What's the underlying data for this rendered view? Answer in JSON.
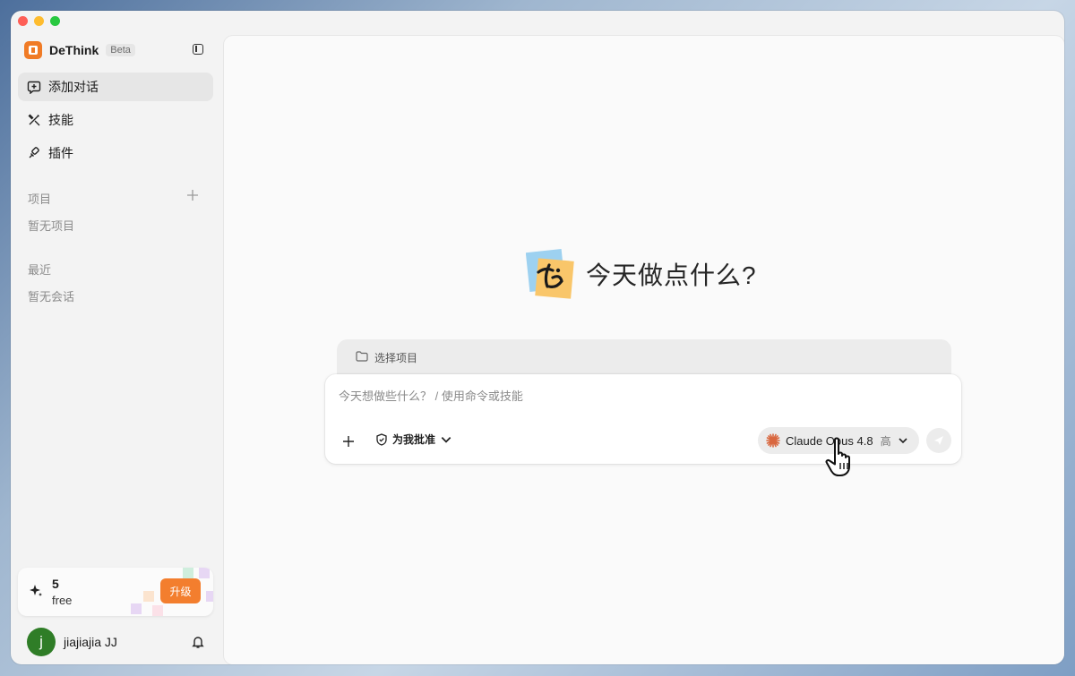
{
  "app": {
    "name": "DeThink",
    "badge": "Beta"
  },
  "sidebar": {
    "nav": [
      {
        "label": "添加对话",
        "icon": "new-chat-icon"
      },
      {
        "label": "技能",
        "icon": "skills-icon"
      },
      {
        "label": "插件",
        "icon": "plugin-icon"
      }
    ],
    "projects": {
      "title": "项目",
      "empty": "暂无项目"
    },
    "recent": {
      "title": "最近",
      "empty": "暂无会话"
    },
    "credits": {
      "count": "5",
      "plan": "free",
      "upgrade_label": "升级"
    },
    "user": {
      "initial": "j",
      "name": "jiajiajia JJ"
    }
  },
  "main": {
    "greeting": "今天做点什么?",
    "project_selector": "选择项目",
    "composer": {
      "placeholder": "今天想做些什么？ / 使用命令或技能",
      "approval_label": "为我批准",
      "model_name": "Claude Opus 4.8",
      "model_level": "高"
    }
  },
  "colors": {
    "accent": "#f37e2e",
    "avatar": "#2f7d27",
    "model_burst": "#d9673f"
  }
}
